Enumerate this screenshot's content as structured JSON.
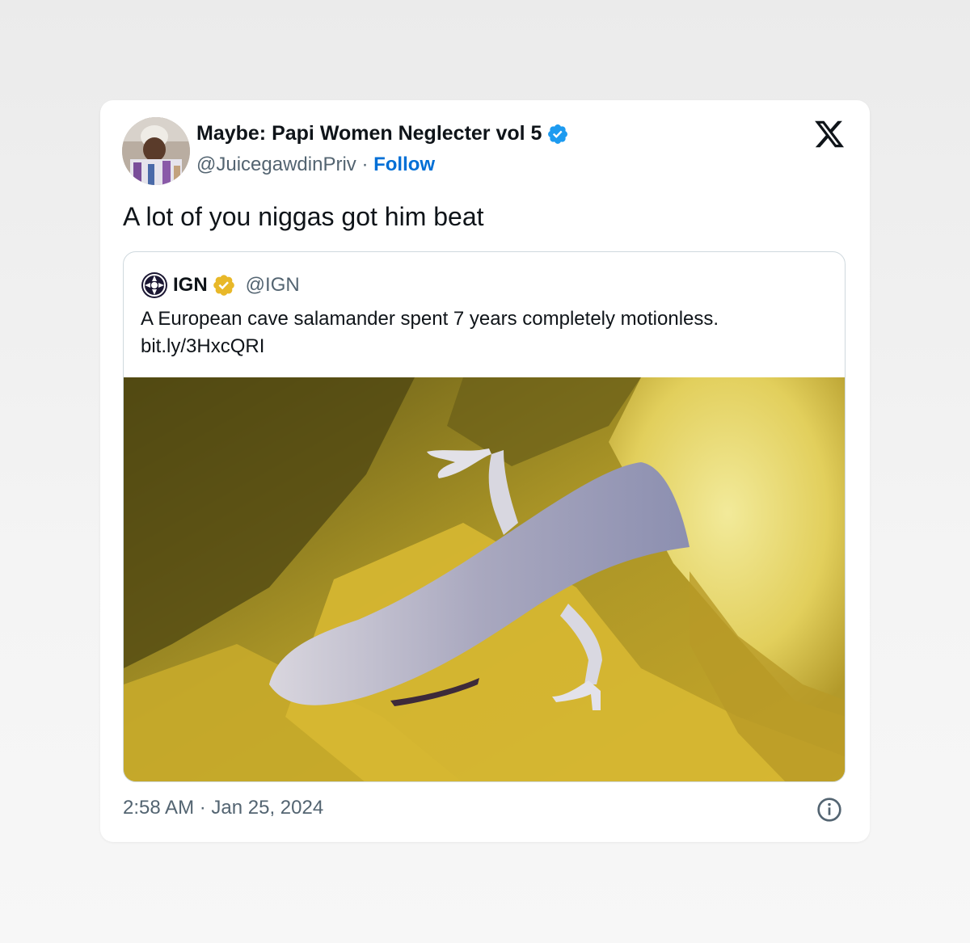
{
  "author": {
    "display_name": "Maybe: Papi Women Neglecter vol 5",
    "handle": "@JuicegawdinPriv",
    "separator": " · ",
    "follow_label": "Follow",
    "verified_badge_icon": "verified-badge-blue-icon",
    "avatar_icon": "avatar-photo"
  },
  "brand_icon": "x-logo-icon",
  "tweet": {
    "text": "A lot of you niggas got him beat",
    "timestamp": "2:58 AM · Jan 25, 2024"
  },
  "quoted_tweet": {
    "logo_icon": "ign-logo-icon",
    "display_name": "IGN",
    "verified_badge_icon": "verified-badge-gold-icon",
    "handle": "@IGN",
    "text_line_1": "A European cave salamander spent 7 years completely motionless.",
    "text_line_2": "bit.ly/3HxcQRI",
    "media": "cave-salamander-photo"
  },
  "info_icon": "info-circle-icon",
  "colors": {
    "link_blue": "#006fd6",
    "verified_blue": "#1d9bf0",
    "verified_gold": "#e8b829",
    "secondary_text": "#536471",
    "primary_text": "#0f1419",
    "card_border": "#cfd9de"
  }
}
